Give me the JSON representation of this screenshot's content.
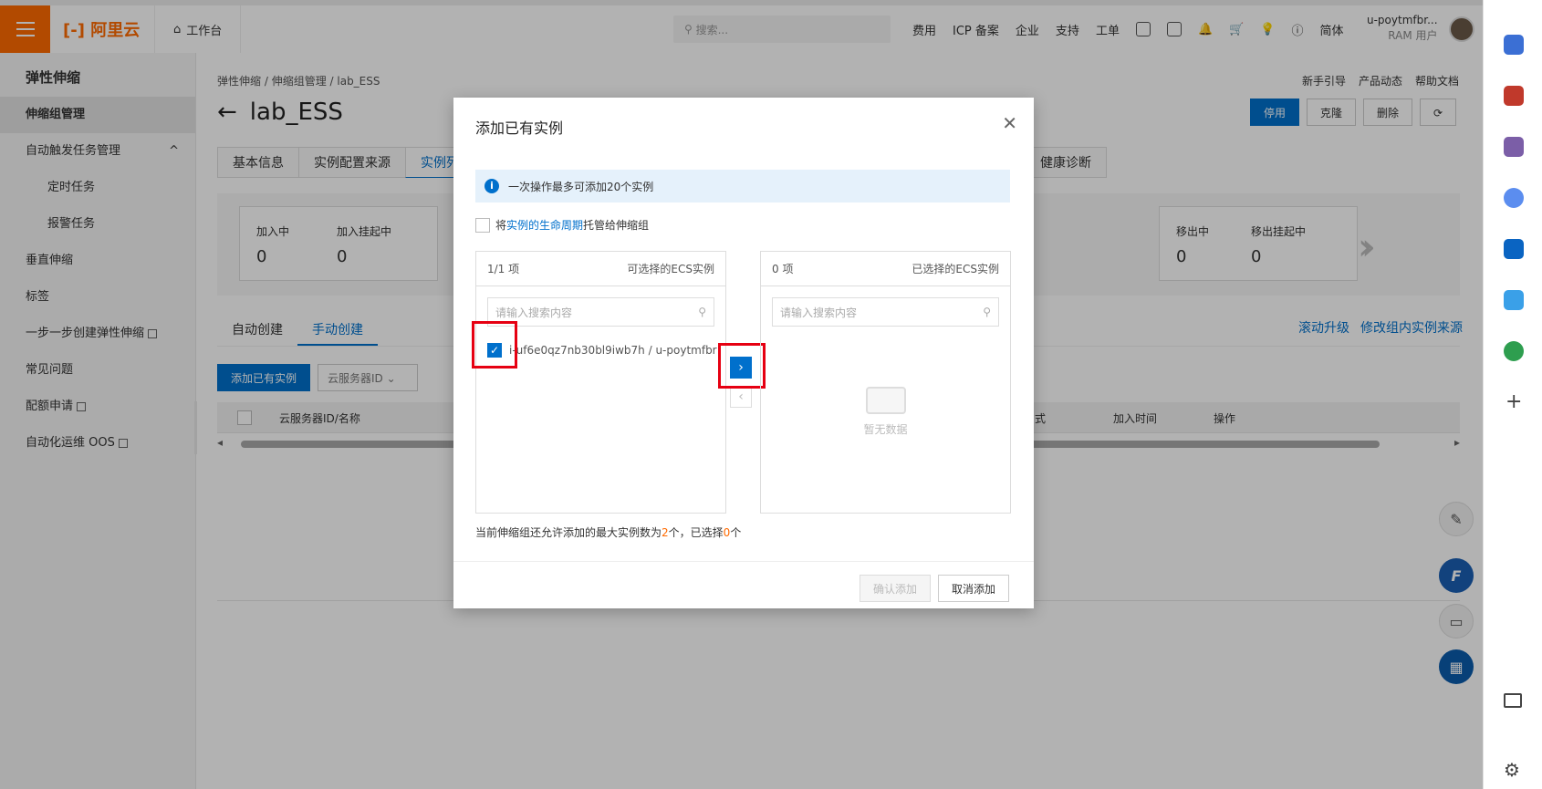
{
  "topbar": {
    "brand": "阿里云",
    "workbench": "工作台",
    "search_placeholder": "搜索...",
    "nav": [
      "费用",
      "ICP 备案",
      "企业",
      "支持",
      "工单"
    ],
    "lang": "简体",
    "user_name": "u-poytmfbr...",
    "user_role": "RAM 用户"
  },
  "sidebar": {
    "title": "弹性伸缩",
    "items": [
      {
        "label": "伸缩组管理"
      },
      {
        "label": "自动触发任务管理"
      },
      {
        "label": "定时任务"
      },
      {
        "label": "报警任务"
      },
      {
        "label": "垂直伸缩"
      },
      {
        "label": "标签"
      },
      {
        "label": "一步一步创建弹性伸缩"
      },
      {
        "label": "常见问题"
      },
      {
        "label": "配额申请"
      },
      {
        "label": "自动化运维 OOS"
      }
    ]
  },
  "page": {
    "breadcrumb": [
      "弹性伸缩",
      "伸缩组管理",
      "lab_ESS"
    ],
    "title": "lab_ESS",
    "top_links": [
      "新手引导",
      "产品动态",
      "帮助文档"
    ],
    "buttons": {
      "stop": "停用",
      "clone": "克隆",
      "delete": "删除"
    },
    "tabs": [
      "基本信息",
      "实例配置来源",
      "实例列表",
      "健康诊断"
    ],
    "stats": {
      "joining": "加入中",
      "joining_val": "0",
      "join_pending": "加入挂起中",
      "join_pending_val": "0",
      "leaving": "移出中",
      "leaving_val": "0",
      "leave_pending": "移出挂起中",
      "leave_pending_val": "0"
    },
    "subtabs": [
      "自动创建",
      "手动创建"
    ],
    "right_links": [
      "滚动升级",
      "修改组内实例来源"
    ],
    "add_button": "添加已有实例",
    "filter_select": "云服务器ID",
    "columns": {
      "id_name": "云服务器ID/名称",
      "mode": "式",
      "join_time": "加入时间",
      "ops": "操作"
    }
  },
  "dialog": {
    "title": "添加已有实例",
    "notice": "一次操作最多可添加20个实例",
    "lifecycle_pre": "将",
    "lifecycle_link": "实例的生命周期",
    "lifecycle_post": "托管给伸缩组",
    "left": {
      "count": "1/1 项",
      "title": "可选择的ECS实例",
      "search_placeholder": "请输入搜索内容",
      "item": "i-uf6e0qz7nb30bl9iwb7h / u-poytmfbr"
    },
    "right": {
      "count": "0 项",
      "title": "已选择的ECS实例",
      "search_placeholder": "请输入搜索内容",
      "empty": "暂无数据"
    },
    "foot_pre": "当前伸缩组还允许添加的最大实例数为",
    "foot_max": "2",
    "foot_mid": "个，已选择",
    "foot_sel": "0",
    "foot_post": "个",
    "confirm": "确认添加",
    "cancel": "取消添加"
  }
}
